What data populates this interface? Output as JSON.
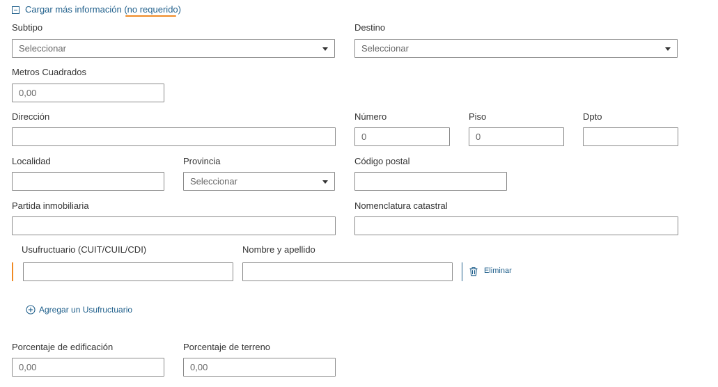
{
  "section": {
    "toggle_label": "Cargar más información (",
    "toggle_emphasis": "no requerido",
    "toggle_close": ")"
  },
  "fields": {
    "subtipo": {
      "label": "Subtipo",
      "value": "Seleccionar"
    },
    "destino": {
      "label": "Destino",
      "value": "Seleccionar"
    },
    "metros": {
      "label": "Metros Cuadrados",
      "value": "0,00"
    },
    "direccion": {
      "label": "Dirección",
      "value": ""
    },
    "numero": {
      "label": "Número",
      "value": "0"
    },
    "piso": {
      "label": "Piso",
      "value": "0"
    },
    "dpto": {
      "label": "Dpto",
      "value": ""
    },
    "localidad": {
      "label": "Localidad",
      "value": ""
    },
    "provincia": {
      "label": "Provincia",
      "value": "Seleccionar"
    },
    "codigo_postal": {
      "label": "Código postal",
      "value": ""
    },
    "partida": {
      "label": "Partida inmobiliaria",
      "value": ""
    },
    "nomenclatura": {
      "label": "Nomenclatura catastral",
      "value": ""
    },
    "usufructuario": {
      "label": "Usufructuario (CUIT/CUIL/CDI)",
      "value": ""
    },
    "nombre": {
      "label": "Nombre y apellido",
      "value": ""
    },
    "porc_edificacion": {
      "label": "Porcentaje de edificación",
      "value": "0,00"
    },
    "porc_terreno": {
      "label": "Porcentaje de terreno",
      "value": "0,00"
    }
  },
  "actions": {
    "delete_label": "Eliminar",
    "add_label": "Agregar un Usufructuario"
  },
  "icons": {
    "toggle": "minus-square-icon",
    "delete": "trash-icon",
    "add": "plus-circle-icon",
    "select_caret": "caret-down-icon"
  },
  "colors": {
    "link": "#1f5f8b",
    "accent": "#f08a24",
    "border": "#8a8a8a",
    "text": "#333333",
    "placeholder": "#666666"
  }
}
